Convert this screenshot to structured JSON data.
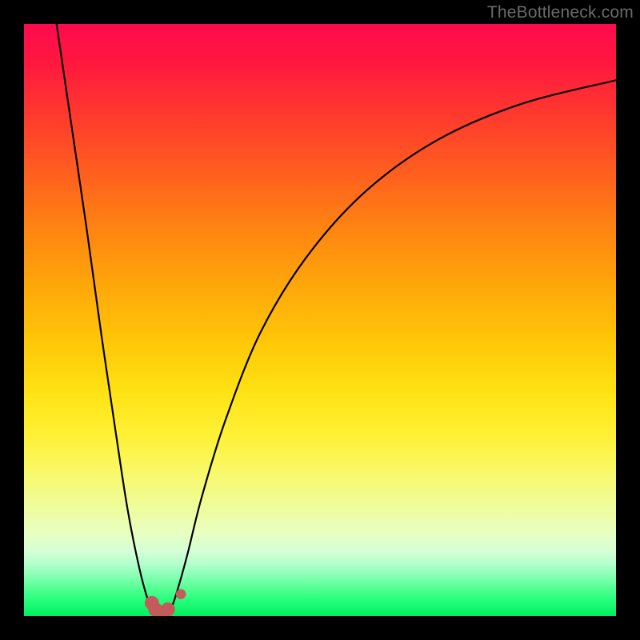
{
  "watermark": "TheBottleneck.com",
  "chart_data": {
    "type": "line",
    "title": "",
    "xlabel": "",
    "ylabel": "",
    "xlim": [
      0,
      100
    ],
    "ylim": [
      0,
      100
    ],
    "series": [
      {
        "name": "left-branch",
        "x": [
          5.5,
          8.0,
          10.5,
          13.0,
          15.5,
          17.5,
          19.5,
          21.0,
          22.0
        ],
        "values": [
          100,
          83,
          66,
          48,
          31,
          18,
          8,
          2.5,
          0.5
        ]
      },
      {
        "name": "right-branch",
        "x": [
          24.5,
          25.5,
          27.5,
          30.0,
          34.0,
          40.0,
          48.0,
          58.0,
          70.0,
          84.0,
          100.0
        ],
        "values": [
          0.5,
          3.0,
          10.0,
          20.0,
          33.0,
          48.0,
          61.0,
          72.0,
          80.5,
          86.5,
          90.5
        ]
      }
    ],
    "markers": [
      {
        "x": 21.6,
        "y": 2.2,
        "r": 1.2
      },
      {
        "x": 22.2,
        "y": 1.1,
        "r": 1.2
      },
      {
        "x": 22.9,
        "y": 0.6,
        "r": 1.2
      },
      {
        "x": 23.6,
        "y": 0.6,
        "r": 1.2
      },
      {
        "x": 24.3,
        "y": 1.1,
        "r": 1.2
      },
      {
        "x": 26.5,
        "y": 3.7,
        "r": 0.85
      }
    ],
    "marker_color": "#c45a5a",
    "curve_color": "#000000",
    "gradient_stops": [
      {
        "offset": 0,
        "color": "#ff0a4e"
      },
      {
        "offset": 100,
        "color": "#00f060"
      }
    ]
  }
}
